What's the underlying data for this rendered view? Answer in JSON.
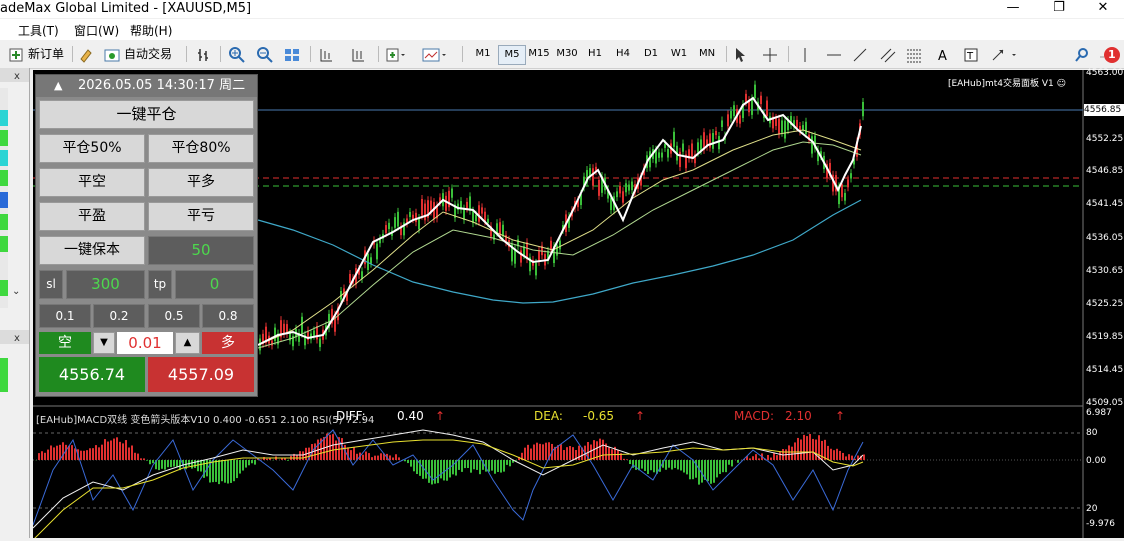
{
  "window": {
    "title": "adeMax Global Limited - [XAUUSD,M5]",
    "min": "—",
    "max": "❐",
    "close": "✕"
  },
  "menu": {
    "tools": "工具(T)",
    "window": "窗口(W)",
    "help": "帮助(H)"
  },
  "toolbar": {
    "new_order": "新订单",
    "auto_trade": "自动交易",
    "timeframes": [
      "M1",
      "M5",
      "M15",
      "M30",
      "H1",
      "H4",
      "D1",
      "W1",
      "MN"
    ],
    "active_tf": "M5",
    "notif_count": "1"
  },
  "panel": {
    "datetime": "2026.05.05 14:30:17 周二",
    "close_all": "一键平仓",
    "close50": "平仓50%",
    "close80": "平仓80%",
    "close_short": "平空",
    "close_long": "平多",
    "close_profit": "平盈",
    "close_loss": "平亏",
    "breakeven": "一键保本",
    "breakeven_val": "50",
    "sl_label": "sl",
    "sl_val": "300",
    "tp_label": "tp",
    "tp_val": "0",
    "lots": [
      "0.1",
      "0.2",
      "0.5",
      "0.8"
    ],
    "sell_label": "空",
    "lot_val": "0.01",
    "buy_label": "多",
    "bid": "4556.74",
    "ask": "4557.09"
  },
  "chart": {
    "ea_label": "[EAHub]mt4交易面板 V1 ☺",
    "price_axis": [
      "4563.00",
      "4556.85",
      "4552.25",
      "4546.85",
      "4541.45",
      "4536.05",
      "4530.65",
      "4525.25",
      "4519.85",
      "4514.45",
      "4509.05"
    ],
    "current_price": "4556.85"
  },
  "indicator": {
    "name": "[EAHub]MACD双线 变色箭头版本V10 0.400 -0.651 2.100  RSI(5) 72.94",
    "diff_label": "DIFF:",
    "diff_val": "0.40",
    "dea_label": "DEA:",
    "dea_val": "-0.65",
    "macd_label": "MACD:",
    "macd_val": "2.10",
    "axis": [
      "6.987",
      "80",
      "0.00",
      "20",
      "-9.976"
    ]
  },
  "colors": {
    "panel_bg": "#8a8a8a",
    "buy": "#c83232",
    "sell": "#1f8a1f",
    "ma_white": "#ffffff",
    "ma_cyan": "#3fa8c8",
    "ma_yellow": "#e0e08a"
  }
}
